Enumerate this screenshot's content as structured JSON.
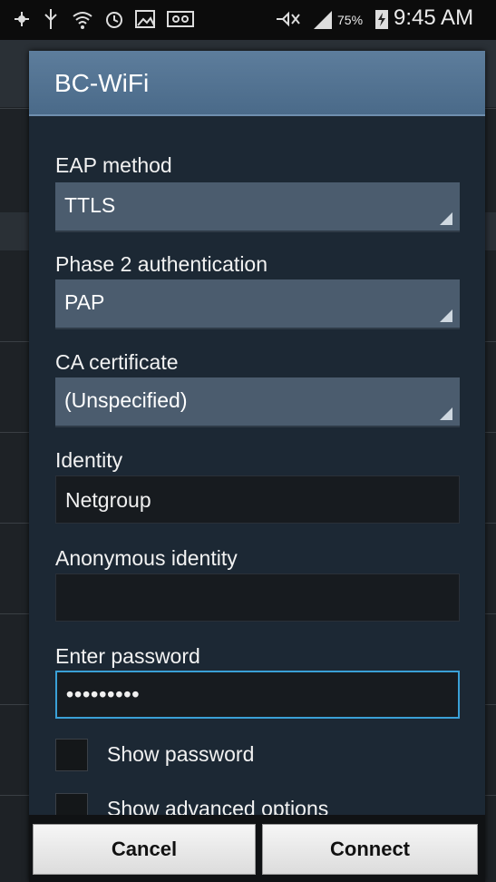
{
  "status_bar": {
    "battery_percent": "75%",
    "time": "9:45 AM",
    "icons": [
      "wifi-signal-icon",
      "usb-icon",
      "wifi-icon",
      "alarm-icon",
      "image-icon",
      "voicemail-icon",
      "mute-icon",
      "cell-signal-icon",
      "battery-charging-icon"
    ]
  },
  "dialog": {
    "title": "BC-WiFi",
    "eap_method": {
      "label": "EAP method",
      "value": "TTLS"
    },
    "phase2": {
      "label": "Phase 2 authentication",
      "value": "PAP"
    },
    "ca_cert": {
      "label": "CA certificate",
      "value": "(Unspecified)"
    },
    "identity": {
      "label": "Identity",
      "value": "Netgroup"
    },
    "anon_identity": {
      "label": "Anonymous identity",
      "value": ""
    },
    "password": {
      "label": "Enter password",
      "value": "•••••••••"
    },
    "show_password": {
      "label": "Show password",
      "checked": false
    },
    "show_advanced": {
      "label": "Show advanced options",
      "checked": false
    },
    "cancel_label": "Cancel",
    "connect_label": "Connect"
  }
}
